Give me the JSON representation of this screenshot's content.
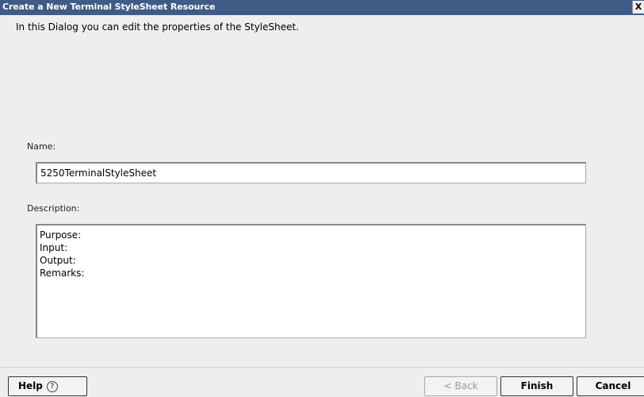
{
  "window": {
    "title": "Create a New Terminal StyleSheet Resource",
    "close_label": "X"
  },
  "intro_text": "In this Dialog you can edit the properties of the StyleSheet.",
  "name_field": {
    "label": "Name:",
    "value": "5250TerminalStyleSheet"
  },
  "description_field": {
    "label": "Description:",
    "lines": [
      "Purpose:",
      "Input:",
      "Output:",
      "Remarks:"
    ]
  },
  "buttons": {
    "help": "Help",
    "help_icon": "?",
    "back": "< Back",
    "finish": "Finish",
    "cancel": "Cancel"
  }
}
